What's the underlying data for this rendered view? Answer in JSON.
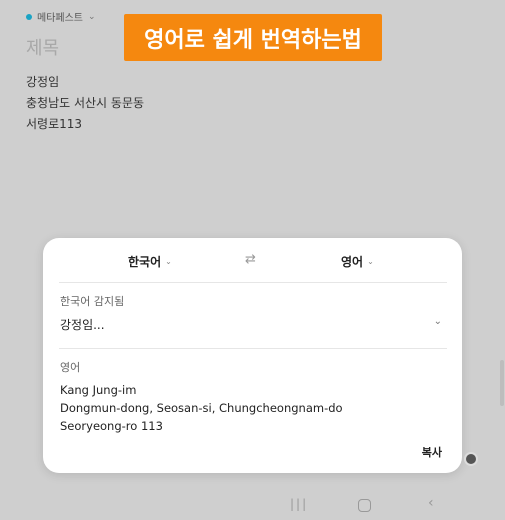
{
  "note": {
    "category": "메타페스트",
    "title_placeholder": "제목",
    "lines": [
      "강정임",
      "충청남도 서산시 동문동",
      "서령로113"
    ]
  },
  "banner": {
    "text": "영어로 쉽게 번역하는법"
  },
  "translator": {
    "source_lang": "한국어",
    "target_lang": "영어",
    "swap_icon": "swap-arrows-icon",
    "detected_label": "한국어 감지됨",
    "source_preview": "강정임...",
    "target_label": "영어",
    "result_lines": [
      "Kang Jung-im",
      "Dongmun-dong, Seosan-si, Chungcheongnam-do",
      "Seoryeong-ro 113"
    ],
    "copy_label": "복사"
  },
  "colors": {
    "banner": "#f5880f",
    "category_dot": "#1aa3c4",
    "background": "#cfcfcf"
  }
}
